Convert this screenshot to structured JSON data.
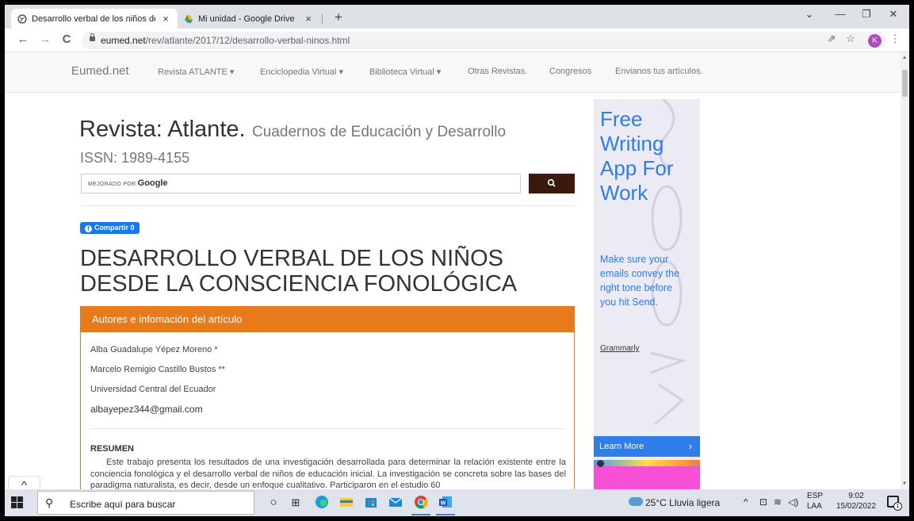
{
  "browser": {
    "tabs": [
      {
        "title": "Desarrollo verbal de los niños de",
        "close": "×",
        "active": true
      },
      {
        "title": "Mi unidad - Google Drive",
        "close": "×",
        "active": false
      }
    ],
    "new_tab": "+",
    "window_controls": {
      "menu": "⌄",
      "minimize": "—",
      "maximize": "❐",
      "close": "✕"
    },
    "nav": {
      "back": "←",
      "forward": "→",
      "reload": "C"
    },
    "url_host": "eumed.net",
    "url_path": "/rev/atlante/2017/12/desarrollo-verbal-ninos.html",
    "toolbar_icons": {
      "share": "⇗",
      "star": "☆",
      "menu": "⋮"
    },
    "profile_initial": "K"
  },
  "site_nav": {
    "brand": "Eumed.net",
    "items": [
      "Revista ATLANTE ▾",
      "Enciclopedia Virtual ▾",
      "Biblioteca Virtual ▾",
      "Otras Revistas.",
      "Congresos",
      "Envianos tus artículos."
    ]
  },
  "journal": {
    "title": "Revista: Atlante.",
    "subtitle": "Cuadernos de Educación y Desarrollo",
    "issn": "ISSN: 1989-4155"
  },
  "search": {
    "powered_by": "MEJORADO POR",
    "brand": "Google",
    "button_icon": "search-icon"
  },
  "share": {
    "label": "Compartir 0",
    "fb_glyph": "f"
  },
  "article": {
    "title_line1": "DESARROLLO VERBAL DE LOS NIÑOS",
    "title_line2": "DESDE LA CONSCIENCIA FONOLÓGICA",
    "panel_title": "Autores e infomación del artículo",
    "authors": [
      "Alba Guadalupe Yépez Moreno *",
      "Marcelo Remigio Castillo Bustos **",
      "Universidad Central del Ecuador"
    ],
    "email": "albayepez344@gmail.com",
    "abstract_heading": "RESUMEN",
    "abstract": "Este trabajo presenta los resultados de una investigación desarrollada para determinar la relación existente entre la conciencia fonológica y el desarrollo verbal de niños de educación inicial. La investigación se concreta sobre las bases del paradigma naturalista, es decir, desde un enfoque cualitativo. Participaron en el estudio 60"
  },
  "ad": {
    "headline": [
      "Free",
      "Writing",
      "App For",
      "Work"
    ],
    "body": [
      "Make sure your",
      "emails convey the",
      "right tone before",
      "you hit Send."
    ],
    "brand": "Grammarly",
    "cta": "Learn More",
    "cta_arrow": "›",
    "colors": {
      "accent": "#2e7de8",
      "background": "#eceaf2"
    }
  },
  "scroll_top_button": "^",
  "taskbar": {
    "search_placeholder": "Escribe aquí para buscar",
    "weather": "25°C  Lluvia ligera",
    "tray_arrow": "^",
    "lang_line1": "ESP",
    "lang_line2": "LAA",
    "time": "9:02",
    "date": "15/02/2022",
    "notifications": "1"
  },
  "colors": {
    "panel_orange": "#e87a1a",
    "search_button": "#3b1a0d",
    "facebook": "#1877f2"
  }
}
